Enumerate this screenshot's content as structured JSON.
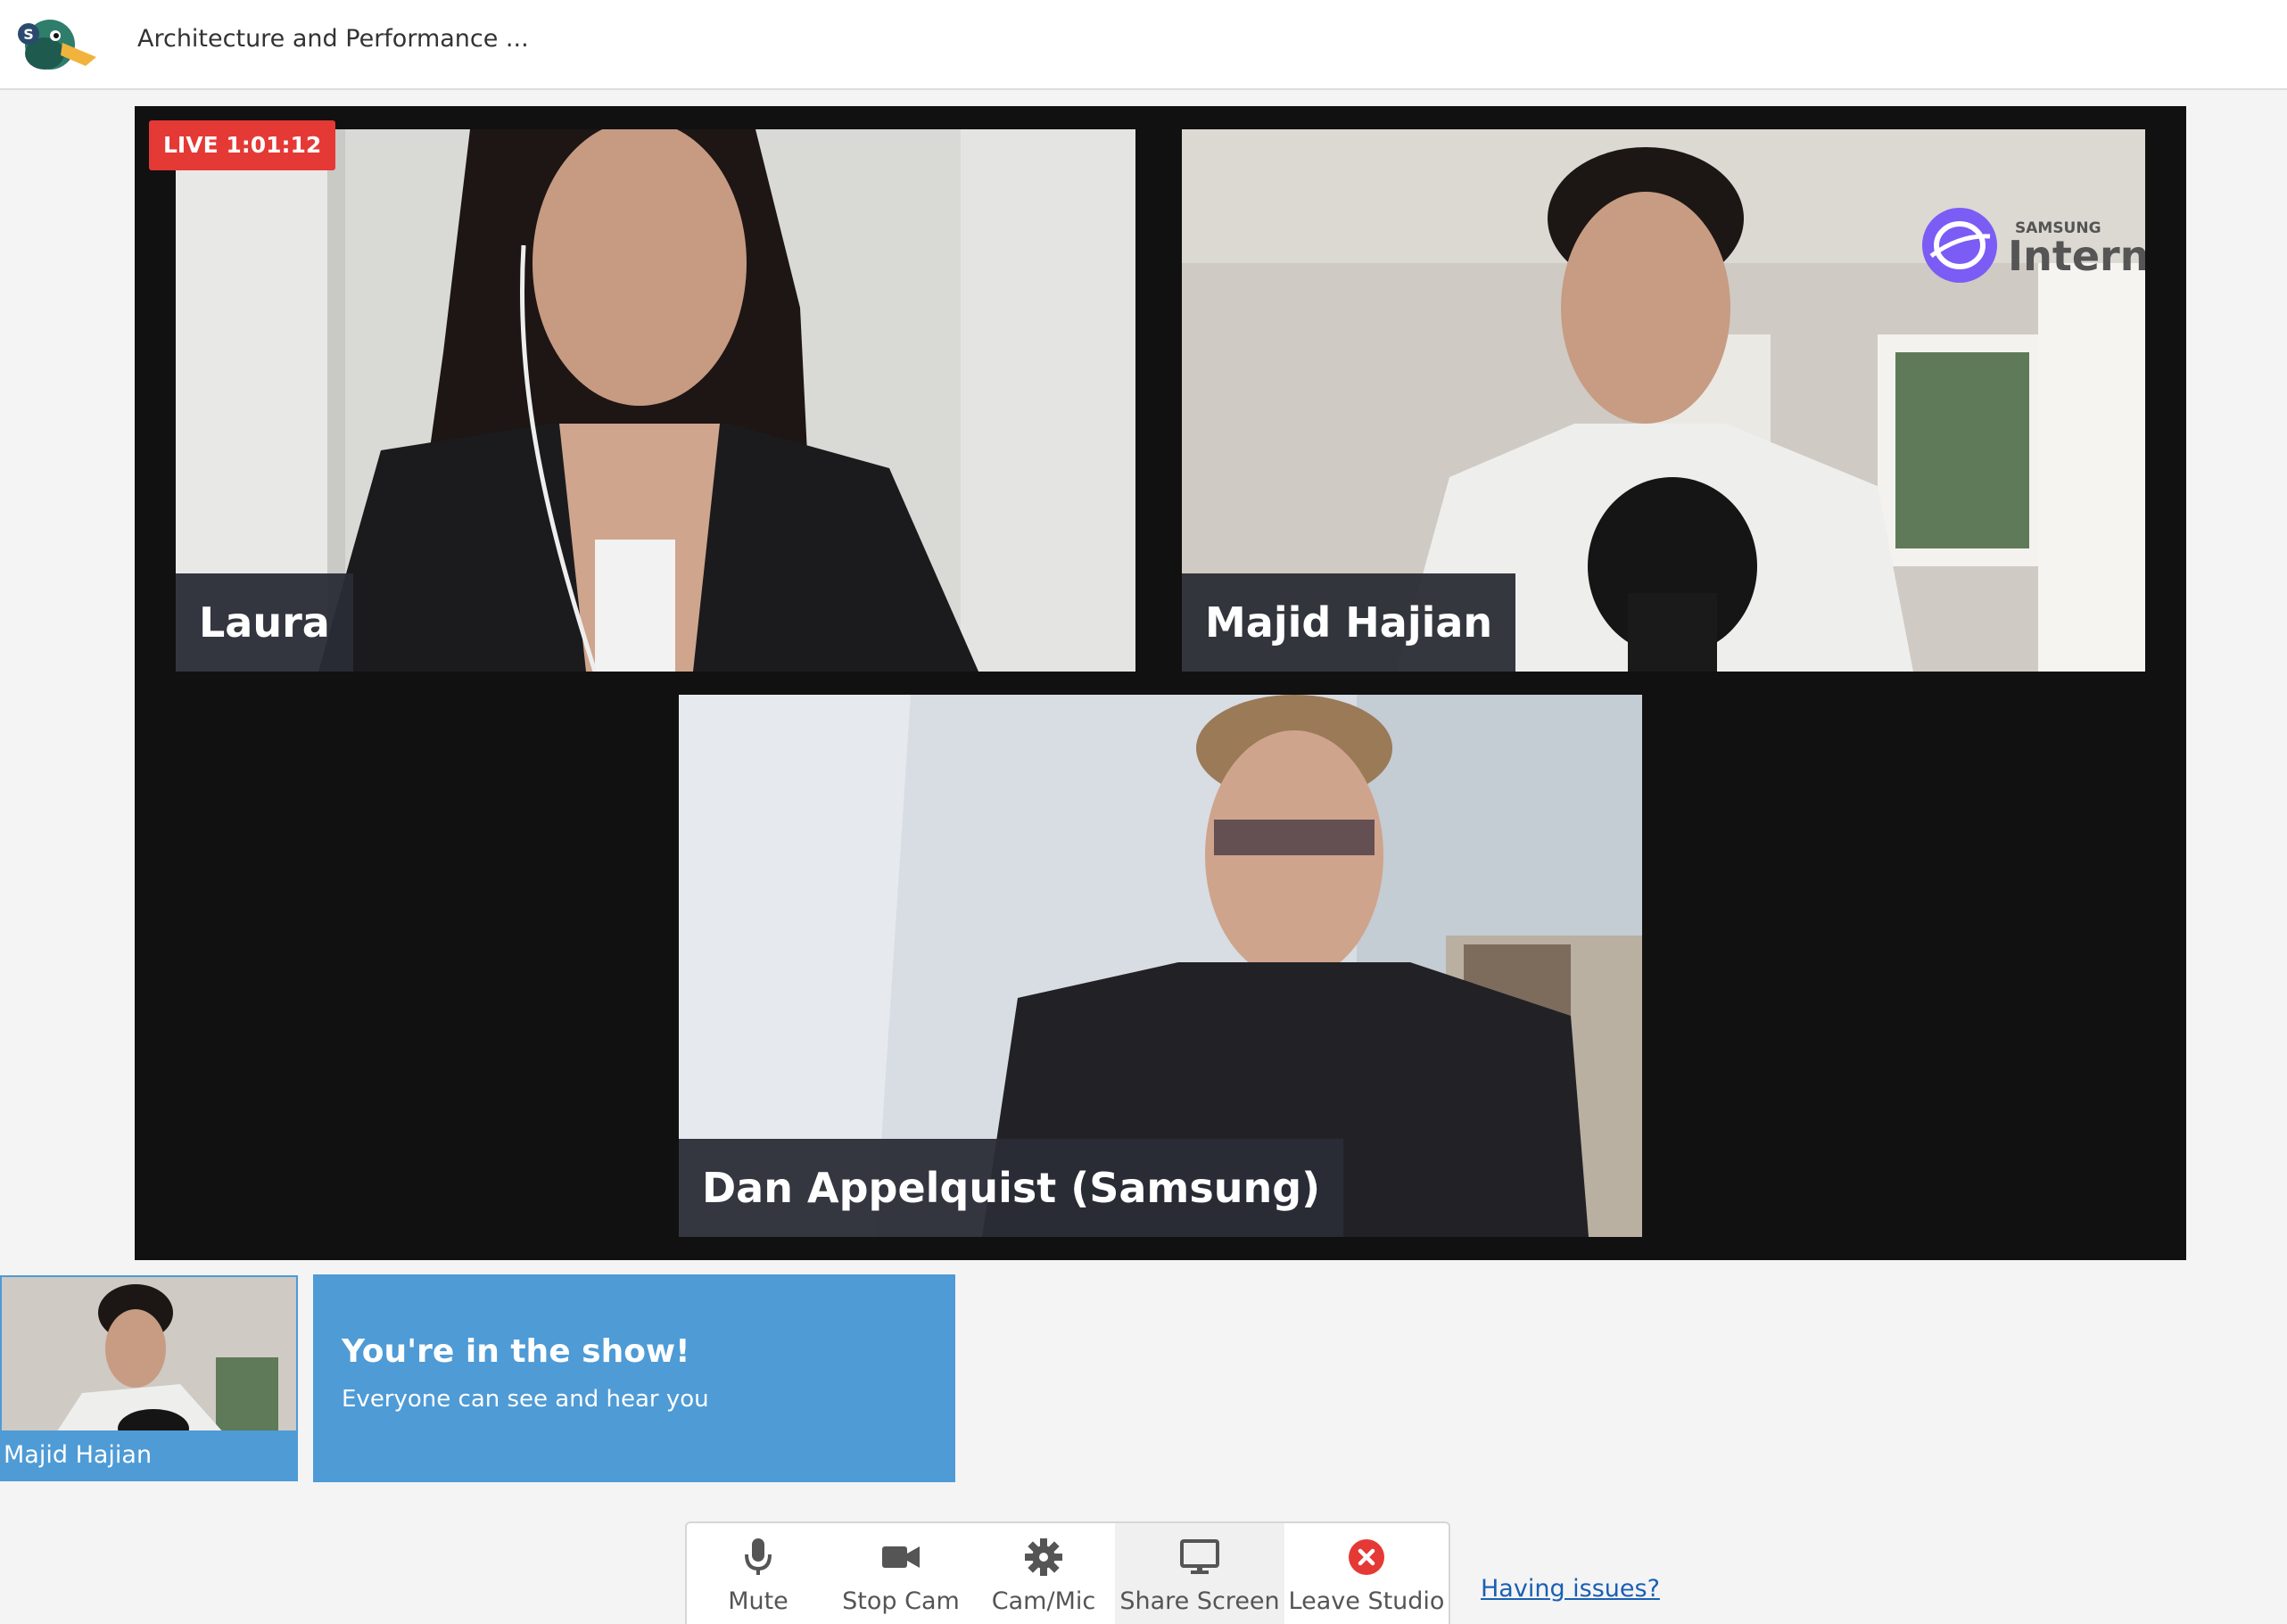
{
  "header": {
    "title": "Architecture and Performance ...",
    "logo_icon": "duck-logo-icon"
  },
  "stage": {
    "live_label": "LIVE 1:01:12",
    "participants": [
      {
        "name": "Laura"
      },
      {
        "name": "Majid Hajian"
      },
      {
        "name": "Dan Appelquist (Samsung)"
      }
    ],
    "brand_overlay": {
      "small": "SAMSUNG",
      "large": "Internet"
    }
  },
  "self_view": {
    "name": "Majid Hajian"
  },
  "status_panel": {
    "title": "You're in the show!",
    "subtitle": "Everyone can see and hear you"
  },
  "toolbar": {
    "items": [
      {
        "label": "Mute",
        "icon": "microphone-icon"
      },
      {
        "label": "Stop Cam",
        "icon": "video-camera-icon"
      },
      {
        "label": "Cam/Mic",
        "icon": "gear-icon"
      },
      {
        "label": "Share Screen",
        "icon": "monitor-icon"
      },
      {
        "label": "Leave Studio",
        "icon": "close-circle-icon"
      }
    ]
  },
  "help_link": "Having issues?",
  "colors": {
    "accent": "#4e9bd6",
    "live": "#e53935",
    "leave": "#e53935",
    "stage_bg": "#111111"
  }
}
